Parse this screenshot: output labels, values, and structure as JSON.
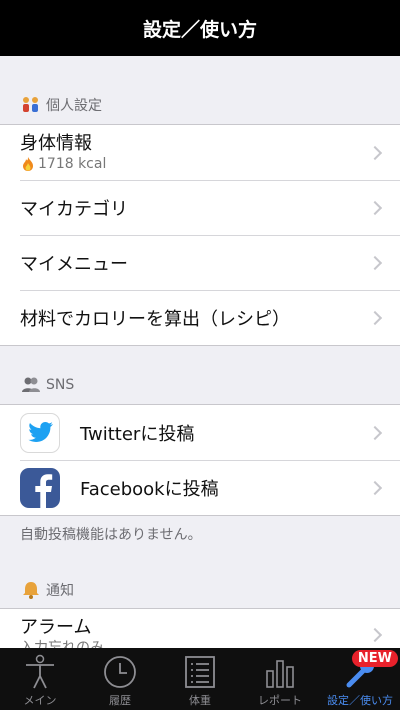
{
  "nav": {
    "title": "設定／使い方"
  },
  "sections": {
    "personal": {
      "header": "個人設定",
      "icon": "couple-icon"
    },
    "sns": {
      "header": "SNS",
      "icon": "users-icon"
    },
    "notify": {
      "header": "通知",
      "icon": "bell-icon"
    }
  },
  "personal_rows": [
    {
      "label": "身体情報",
      "sub": "1718 kcal",
      "sub_icon": "fire-icon"
    },
    {
      "label": "マイカテゴリ"
    },
    {
      "label": "マイメニュー"
    },
    {
      "label": "材料でカロリーを算出（レシピ）"
    }
  ],
  "sns_rows": [
    {
      "label": "Twitterに投稿",
      "icon": "twitter-icon"
    },
    {
      "label": "Facebookに投稿",
      "icon": "facebook-icon"
    }
  ],
  "sns_note": "自動投稿機能はありません。",
  "notify_rows": [
    {
      "label": "アラーム",
      "sub": "入力忘れのみ"
    }
  ],
  "tabs": [
    {
      "label": "メイン",
      "icon": "body-icon"
    },
    {
      "label": "履歴",
      "icon": "clock-icon"
    },
    {
      "label": "体重",
      "icon": "list-icon"
    },
    {
      "label": "レポート",
      "icon": "bar-chart-icon"
    },
    {
      "label": "設定／使い方",
      "icon": "wrench-icon",
      "active": true,
      "badge": "NEW"
    }
  ],
  "colors": {
    "accent": "#4a8cf0",
    "badge": "#e8212b",
    "facebook": "#3b5998",
    "twitter": "#1da1f2"
  }
}
